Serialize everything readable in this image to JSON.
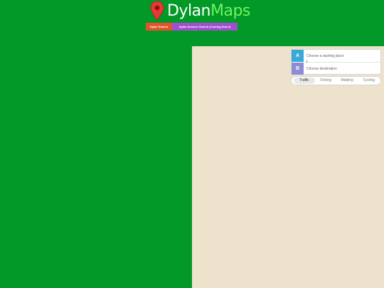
{
  "app": {
    "logo_word1": "Dylan",
    "logo_word2": "Maps",
    "colors": {
      "background": "#029928",
      "logo_accent": "#6ff55a",
      "map": "#ede2cc",
      "pin": "#e53935"
    }
  },
  "search_tabs": [
    {
      "label": "Dylan Search",
      "color": "#e2542b"
    },
    {
      "label": "Dylan Science Search (Coming Soon!)",
      "color": "#a34ed0"
    }
  ],
  "directions": {
    "start_badge": "A",
    "start_placeholder": "Choose a starting place",
    "end_badge": "B",
    "end_placeholder": "Choose destination",
    "swap_icon": "swap-arrows-icon"
  },
  "modes": [
    {
      "label": "Traffic",
      "active": true
    },
    {
      "label": "Driving",
      "active": false
    },
    {
      "label": "Walking",
      "active": false
    },
    {
      "label": "Cycling",
      "active": false
    }
  ]
}
